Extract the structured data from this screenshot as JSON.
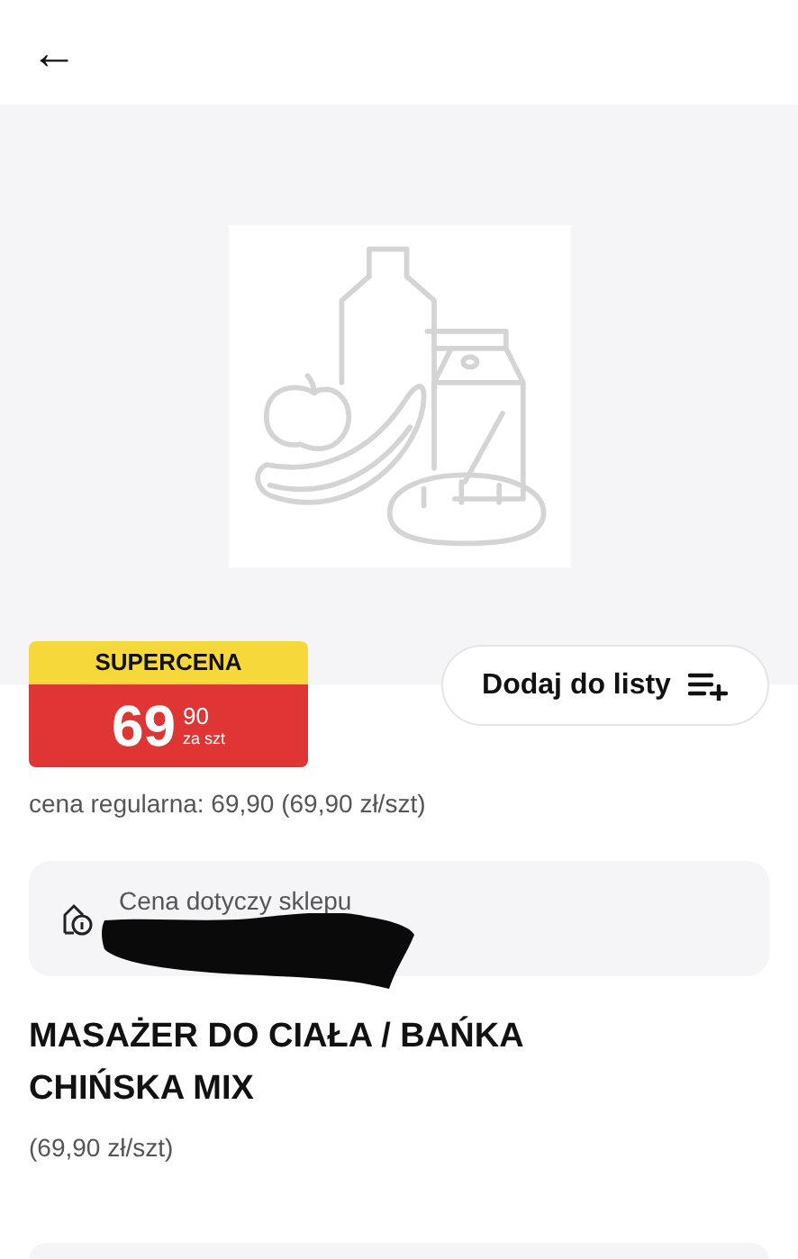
{
  "header": {
    "back_button": "←"
  },
  "product_image": {
    "kind": "placeholder"
  },
  "price_badge": {
    "label": "SUPERCENA",
    "integer": "69",
    "fraction": "90",
    "unit": "za szt"
  },
  "add_to_list_button": {
    "label": "Dodaj do listy"
  },
  "regular_price": "cena regularna: 69,90 (69,90 zł/szt)",
  "store_notice": {
    "label": "Cena dotyczy sklepu"
  },
  "product": {
    "title": "MASAŻER DO CIAŁA / BAŃKA CHIŃSKA MIX",
    "unit_price": "(69,90 zł/szt)"
  }
}
